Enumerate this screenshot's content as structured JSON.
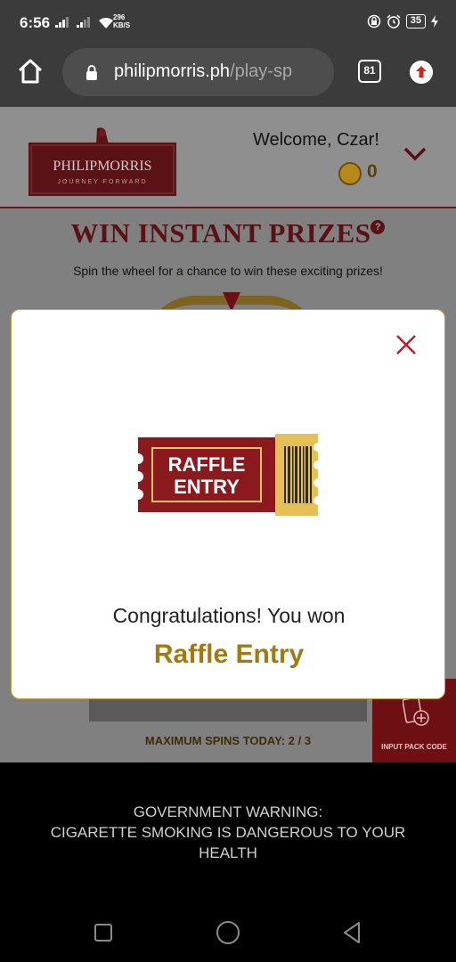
{
  "status_bar": {
    "time": "6:56",
    "net_speed_value": "296",
    "net_speed_unit": "KB/S",
    "battery": "35"
  },
  "browser": {
    "url_host": "philipmorris.ph",
    "url_path": "/play-sp",
    "tab_count": "81"
  },
  "header": {
    "logo_text": "PHILIPMORRIS",
    "logo_tagline": "JOURNEY FORWARD",
    "welcome": "Welcome, Czar!",
    "coins": "0"
  },
  "page": {
    "title": "WIN INSTANT PRIZES",
    "help": "?",
    "subtitle": "Spin the wheel for a chance to win these exciting prizes!",
    "max_spins": "MAXIMUM SPINS TODAY: 2 / 3",
    "pack_code_label": "INPUT PACK CODE"
  },
  "modal": {
    "ticket_line1": "RAFFLE",
    "ticket_line2": "ENTRY",
    "congrats": "Congratulations! You won",
    "prize": "Raffle Entry"
  },
  "warning": {
    "line1": "GOVERNMENT WARNING:",
    "line2": "CIGARETTE SMOKING IS DANGEROUS TO YOUR",
    "line3": "HEALTH"
  },
  "colors": {
    "brand_red": "#7a1319",
    "gold": "#a07a12",
    "status_bar": "#3b3b3b"
  }
}
